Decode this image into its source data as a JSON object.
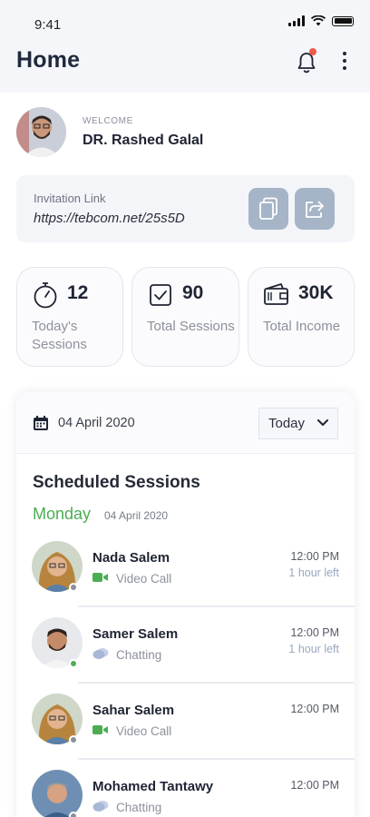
{
  "status_bar": {
    "time": "9:41"
  },
  "header": {
    "title": "Home"
  },
  "profile": {
    "welcome": "WELCOME",
    "name": "DR. Rashed Galal"
  },
  "invitation": {
    "label": "Invitation Link",
    "link": "https://tebcom.net/25s5D"
  },
  "stats": [
    {
      "icon": "stopwatch-icon",
      "value": "12",
      "label": "Today's Sessions"
    },
    {
      "icon": "checkbox-icon",
      "value": "90",
      "label": "Total Sessions"
    },
    {
      "icon": "wallet-icon",
      "value": "30K",
      "label": "Total Income"
    }
  ],
  "sessions": {
    "date": "04 April 2020",
    "filter": "Today",
    "title": "Scheduled Sessions",
    "day": "Monday",
    "day_date": "04 April 2020",
    "items": [
      {
        "name": "Nada Salem",
        "mode": "Video Call",
        "mode_icon": "video-icon",
        "time": "12:00 PM",
        "remaining": "1 hour left",
        "status_color": "#8a8f9c"
      },
      {
        "name": "Samer Salem",
        "mode": "Chatting",
        "mode_icon": "chat-icon",
        "time": "12:00 PM",
        "remaining": "1 hour left",
        "status_color": "#4cad53"
      },
      {
        "name": "Sahar Salem",
        "mode": "Video Call",
        "mode_icon": "video-icon",
        "time": "12:00 PM",
        "remaining": "",
        "status_color": "#8a8f9c"
      },
      {
        "name": "Mohamed Tantawy",
        "mode": "Chatting",
        "mode_icon": "chat-icon",
        "time": "12:00 PM",
        "remaining": "",
        "status_color": "#8a8f9c"
      }
    ]
  },
  "colors": {
    "accent_green": "#4cad53",
    "button_blue": "#a5b4c6",
    "notification_red": "#ef5a4a"
  }
}
